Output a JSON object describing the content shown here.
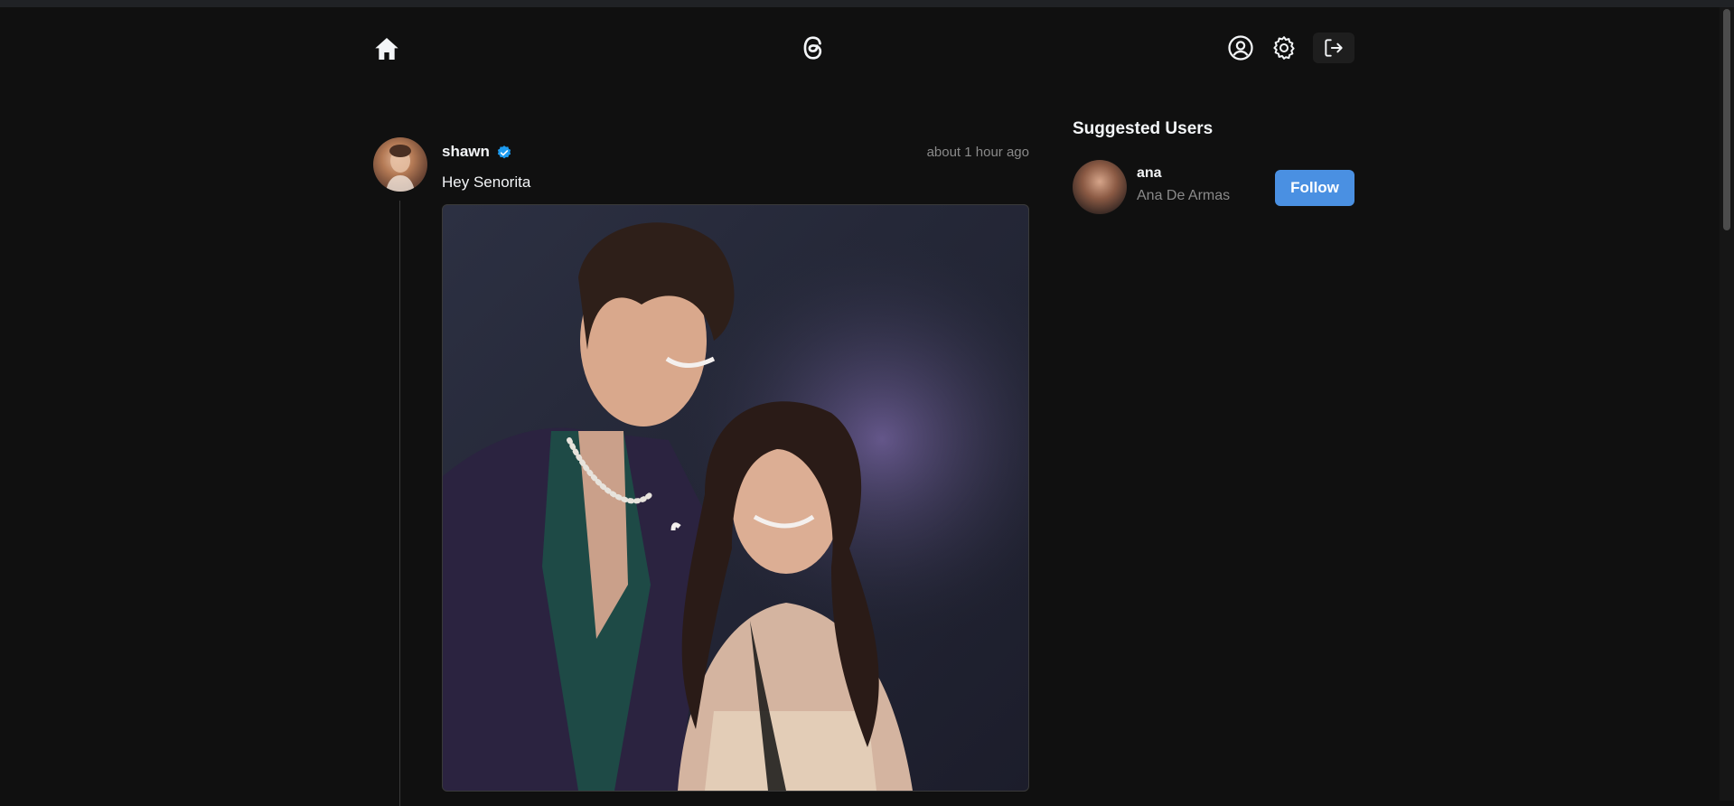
{
  "header": {
    "home_icon": "home-icon",
    "logo_icon": "threads-logo-icon",
    "profile_icon": "user-circle-icon",
    "settings_icon": "gear-icon",
    "logout_icon": "logout-icon"
  },
  "post": {
    "username": "shawn",
    "verified": true,
    "time": "about 1 hour ago",
    "text": "Hey Senorita",
    "image": "post photo of two people smiling"
  },
  "suggested": {
    "title": "Suggested Users",
    "users": [
      {
        "username": "ana",
        "name": "Ana De Armas",
        "button_label": "Follow"
      }
    ]
  },
  "colors": {
    "background": "#101010",
    "text": "#f3f5f7",
    "muted": "#8a8a8a",
    "accent": "#4a90e2"
  }
}
